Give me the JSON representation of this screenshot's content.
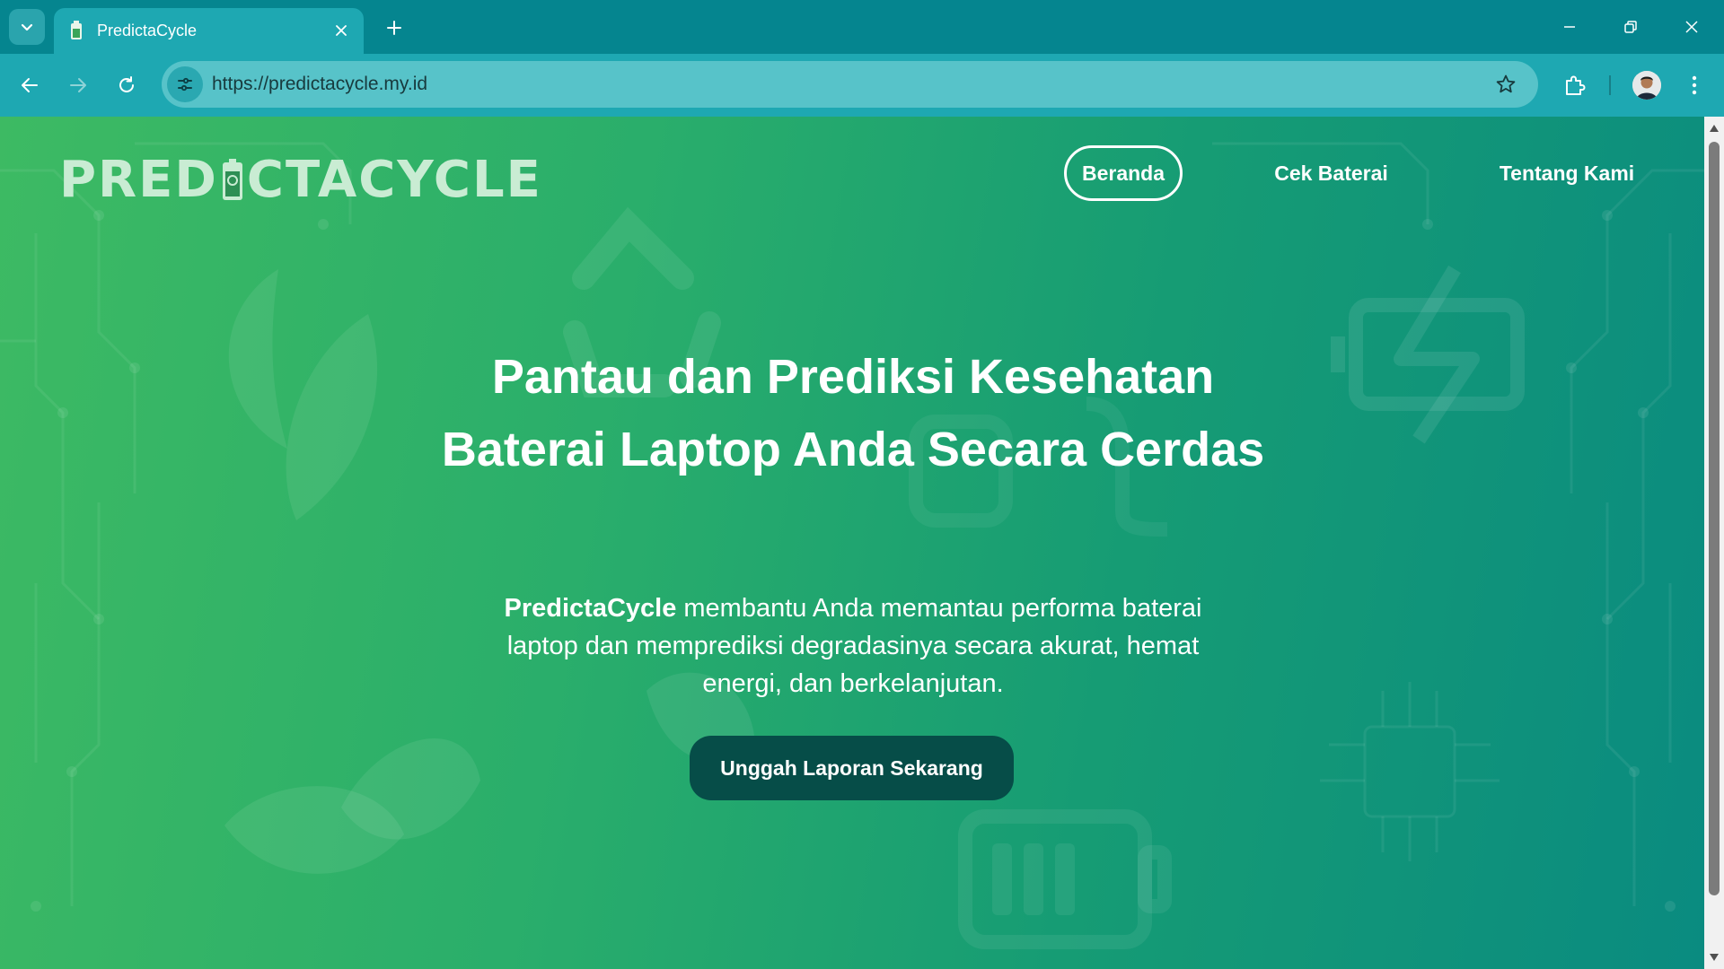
{
  "browser": {
    "tab_title": "PredictaCycle",
    "url": "https://predictacycle.my.id",
    "icons": {
      "tab_search": "chevron-down-icon",
      "tab_close": "close-icon",
      "new_tab": "plus-icon",
      "minimize": "minimize-icon",
      "restore": "restore-icon",
      "close_window": "close-icon",
      "back": "arrow-left-icon",
      "forward": "arrow-right-icon",
      "reload": "reload-icon",
      "site_info": "tune-icon",
      "bookmark": "star-icon",
      "extensions": "puzzle-icon",
      "menu": "kebab-icon"
    }
  },
  "site": {
    "logo_left": "PRED",
    "logo_right": "CTACYCLE",
    "nav": [
      {
        "label": "Beranda",
        "active": true
      },
      {
        "label": "Cek Baterai",
        "active": false
      },
      {
        "label": "Tentang Kami",
        "active": false
      }
    ]
  },
  "hero": {
    "title": "Pantau dan Prediksi Kesehatan Baterai Laptop Anda Secara Cerdas",
    "subtitle_brand": "PredictaCycle",
    "subtitle_rest": " membantu Anda memantau performa baterai laptop dan memprediksi degradasinya secara akurat, hemat energi, dan berkelanjutan.",
    "cta": "Unggah Laporan Sekarang"
  },
  "colors": {
    "chrome_dark": "#05858f",
    "chrome": "#1ea8b2",
    "omnibox": "#57c3c9",
    "gradient_start": "#3dba63",
    "gradient_end": "#0a8b80",
    "cta_bg": "#064d48",
    "logo_text": "#c9ecd3"
  }
}
